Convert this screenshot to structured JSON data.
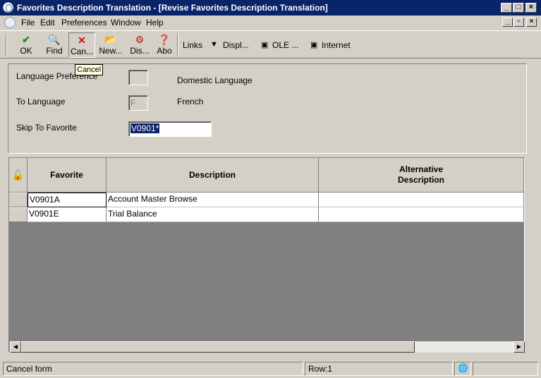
{
  "window": {
    "title": "Favorites Description Translation - [Revise Favorites Description Translation]"
  },
  "menu": {
    "items": [
      "File",
      "Edit",
      "Preferences",
      "Window",
      "Help"
    ]
  },
  "toolbar": {
    "ok": "OK",
    "find": "Find",
    "cancel": "Can...",
    "new": "New...",
    "display": "Dis...",
    "about": "Abo",
    "links": "Links",
    "displ": "Displ...",
    "ole": "OLE ...",
    "internet": "Internet"
  },
  "tooltip": "Cancel",
  "form": {
    "language_preference_label": "Language Preference",
    "language_preference_value": "",
    "language_preference_desc": "Domestic Language",
    "to_language_label": "To Language",
    "to_language_value": "F",
    "to_language_desc": "French",
    "skip_to_label": "Skip To Favorite",
    "skip_to_value": "V0901*"
  },
  "grid": {
    "columns": [
      "Favorite",
      "Description",
      "Alternative\nDescription"
    ],
    "rows": [
      {
        "favorite": "V0901A",
        "description": "Account Master Browse",
        "alt": ""
      },
      {
        "favorite": "V0901E",
        "description": "Trial Balance",
        "alt": ""
      }
    ]
  },
  "status": {
    "message": "Cancel form",
    "row": "Row:1"
  }
}
